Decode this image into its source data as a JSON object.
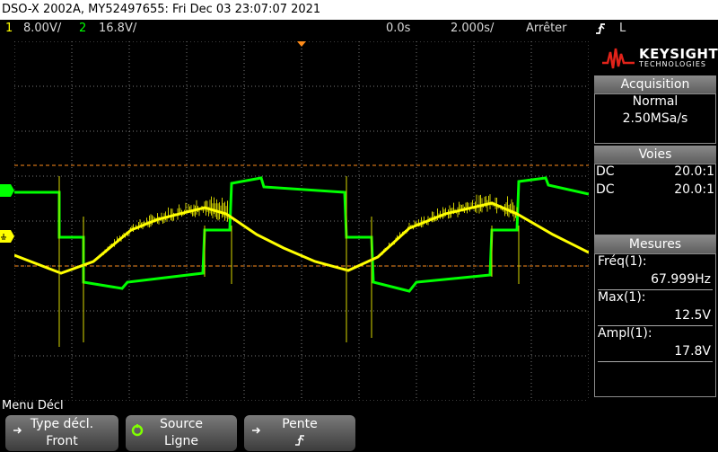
{
  "title": "DSO-X 2002A, MY52497655: Fri Dec 03 23:07:07 2021",
  "topbar": {
    "ch1_num": "1",
    "ch1_scale": "8.00V/",
    "ch2_num": "2",
    "ch2_scale": "16.8V/",
    "time_offset": "0.0s",
    "time_scale": "2.000s/",
    "run_state": "Arrêter",
    "trigger_source": "L"
  },
  "brand": {
    "name": "KEYSIGHT",
    "sub": "TECHNOLOGIES"
  },
  "acquisition": {
    "header": "Acquisition",
    "mode": "Normal",
    "rate": "2.50MSa/s"
  },
  "voies": {
    "header": "Voies",
    "rows": [
      {
        "coupling": "DC",
        "ratio": "20.0:1",
        "color": "#ffff00"
      },
      {
        "coupling": "DC",
        "ratio": "20.0:1",
        "color": "#00ff00"
      }
    ]
  },
  "mesures": {
    "header": "Mesures",
    "items": [
      {
        "label": "Fréq(1):",
        "value": "67.999Hz"
      },
      {
        "label": "Max(1):",
        "value": "12.5V"
      },
      {
        "label": "Ampl(1):",
        "value": "17.8V"
      }
    ]
  },
  "menu": {
    "label": "Menu Décl",
    "buttons": [
      {
        "top": "Type décl.",
        "bottom": "Front"
      },
      {
        "top": "Source",
        "bottom": "Ligne"
      },
      {
        "top": "Pente",
        "bottom": ""
      }
    ]
  },
  "colors": {
    "ch1": "#ffff00",
    "ch2": "#00ff00",
    "cursor": "#ff8c1a",
    "grid": "#7a7a7a"
  }
}
